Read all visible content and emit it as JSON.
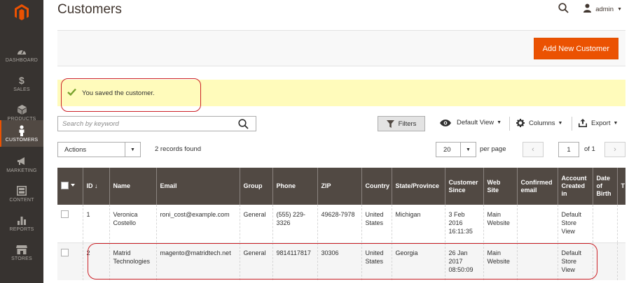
{
  "colors": {
    "accent": "#eb5202",
    "sidebar_bg": "#373330",
    "grid_header": "#514943",
    "success_bg": "#fffbbb",
    "highlight": "#cc2127"
  },
  "sidebar": {
    "items": [
      {
        "label": "DASHBOARD",
        "icon": "dashboard-icon"
      },
      {
        "label": "SALES",
        "icon": "dollar-icon"
      },
      {
        "label": "PRODUCTS",
        "icon": "cube-icon"
      },
      {
        "label": "CUSTOMERS",
        "icon": "person-icon",
        "active": true
      },
      {
        "label": "MARKETING",
        "icon": "megaphone-icon"
      },
      {
        "label": "CONTENT",
        "icon": "layout-icon"
      },
      {
        "label": "REPORTS",
        "icon": "bar-chart-icon"
      },
      {
        "label": "STORES",
        "icon": "store-icon"
      }
    ]
  },
  "header": {
    "title": "Customers",
    "user": "admin"
  },
  "action_bar": {
    "add_button": "Add New Customer"
  },
  "message": {
    "text": "You saved the customer."
  },
  "toolbar": {
    "search_placeholder": "Search by keyword",
    "filters": "Filters",
    "view": "Default View",
    "columns": "Columns",
    "export": "Export",
    "actions": "Actions",
    "records_found": "2 records found",
    "per_page_value": "20",
    "per_page_label": "per page",
    "page_current": "1",
    "page_total": "of 1"
  },
  "grid": {
    "columns": [
      "ID",
      "Name",
      "Email",
      "Group",
      "Phone",
      "ZIP",
      "Country",
      "State/Province",
      "Customer Since",
      "Web Site",
      "Confirmed email",
      "Account Created in",
      "Date of Birth",
      "T"
    ],
    "sort_indicator": "↓",
    "rows": [
      {
        "id": "1",
        "name": "Veronica Costello",
        "email": "roni_cost@example.com",
        "group": "General",
        "phone": "(555) 229-3326",
        "zip": "49628-7978",
        "country": "United States",
        "state": "Michigan",
        "since": "3 Feb 2016 16:11:35",
        "website": "Main Website",
        "confirmed": "",
        "created_in": "Default Store View",
        "dob": ""
      },
      {
        "id": "2",
        "name": "Matrid Technologies",
        "email": "magento@matridtech.net",
        "group": "General",
        "phone": "9814117817",
        "zip": "30306",
        "country": "United States",
        "state": "Georgia",
        "since": "26 Jan 2017 08:50:09",
        "website": "Main Website",
        "confirmed": "",
        "created_in": "Default Store View",
        "dob": ""
      }
    ]
  }
}
